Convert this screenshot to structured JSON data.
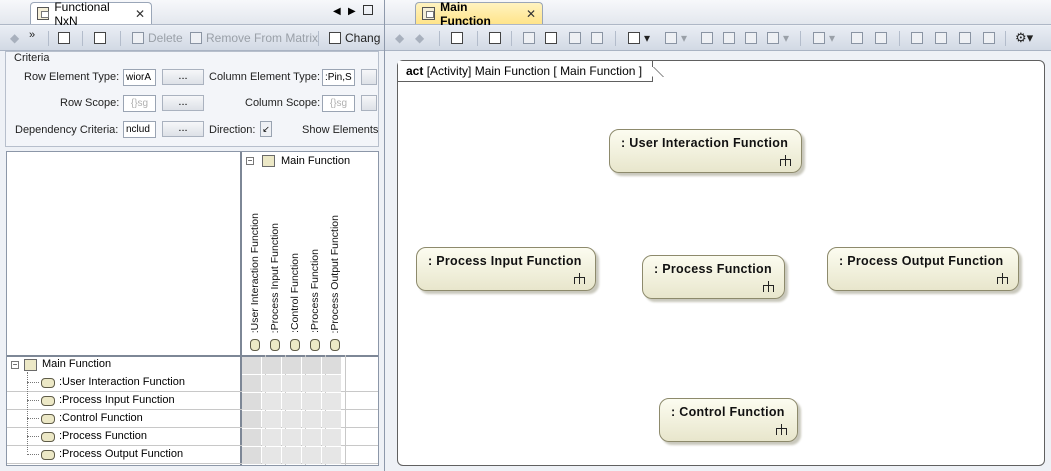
{
  "left_panel": {
    "tab_title": "Functional NxN",
    "toolbar": {
      "overflow": "»",
      "delete_label": "Delete",
      "remove_label": "Remove From Matrix",
      "change_label": "Chang"
    },
    "criteria": {
      "title": "Criteria",
      "row_element_type_label": "Row Element Type:",
      "row_element_type_value": "wiorA",
      "row_scope_label": "Row Scope:",
      "dependency_criteria_label": "Dependency Criteria:",
      "dependency_criteria_value": "nclud",
      "column_element_type_label": "Column Element Type:",
      "column_element_type_value": ":Pin,S",
      "column_scope_label": "Column Scope:",
      "direction_label": "Direction:",
      "show_elements_label": "Show Elements",
      "scope_placeholder": "{}sg",
      "ellipsis": "...",
      "direction_glyph": "↙"
    },
    "matrix": {
      "column_root": "Main Function",
      "columns": [
        ":User Interaction Function",
        ":Process Input Function",
        ":Control Function",
        ":Process Function",
        ":Process Output Function"
      ],
      "row_root": "Main Function",
      "rows": [
        ":User Interaction Function",
        ":Process Input Function",
        ":Control Function",
        ":Process Function",
        ":Process Output Function"
      ]
    }
  },
  "right_panel": {
    "tab_title": "Main Function",
    "frame": {
      "keyword": "act",
      "label": "[Activity] Main Function [ Main Function ]"
    },
    "actions": [
      {
        "id": "user-interaction",
        "name": ": User Interaction Function"
      },
      {
        "id": "process-input",
        "name": ": Process Input Function"
      },
      {
        "id": "process",
        "name": ": Process Function"
      },
      {
        "id": "process-output",
        "name": ": Process Output Function"
      },
      {
        "id": "control",
        "name": ": Control Function"
      }
    ]
  },
  "colors": {
    "action_fill": "#f4f2dc",
    "active_tab": "#ffe48a",
    "panel_bg": "#eef1f6"
  }
}
